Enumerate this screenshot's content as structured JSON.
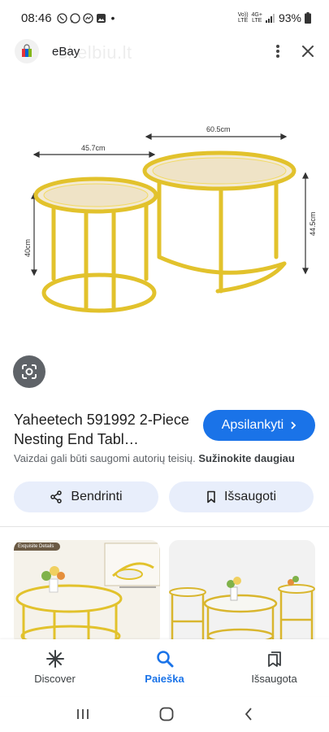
{
  "status_bar": {
    "time": "08:46",
    "network": "VoLTE 4G+",
    "network_top": "Vo))",
    "network_bottom": "LTE",
    "lte_top": "4G+",
    "lte_bottom": "LTE",
    "battery": "93%"
  },
  "header": {
    "site_name": "eBay",
    "watermark": "skelbiu.lt"
  },
  "main_image": {
    "dimensions": {
      "width_large": "60.5cm",
      "width_small": "45.7cm",
      "height_small": "40cm",
      "height_large": "44.5cm"
    }
  },
  "result": {
    "title": "Yaheetech 591992 2-Piece Nesting End Tabl…",
    "visit_label": "Apsilankyti",
    "copyright_text": "Vaizdai gali būti saugomi autorių teisių. ",
    "copyright_link": "Sužinokite daugiau"
  },
  "actions": {
    "share_label": "Bendrinti",
    "save_label": "Išsaugoti"
  },
  "related": {
    "tag": "Exquisite Details"
  },
  "bottom_nav": {
    "items": [
      {
        "label": "Discover"
      },
      {
        "label": "Paieška"
      },
      {
        "label": "Išsaugota"
      }
    ]
  },
  "colors": {
    "accent": "#1a73e8",
    "gold": "#e2c22c",
    "pill_bg": "#e8eefb"
  }
}
